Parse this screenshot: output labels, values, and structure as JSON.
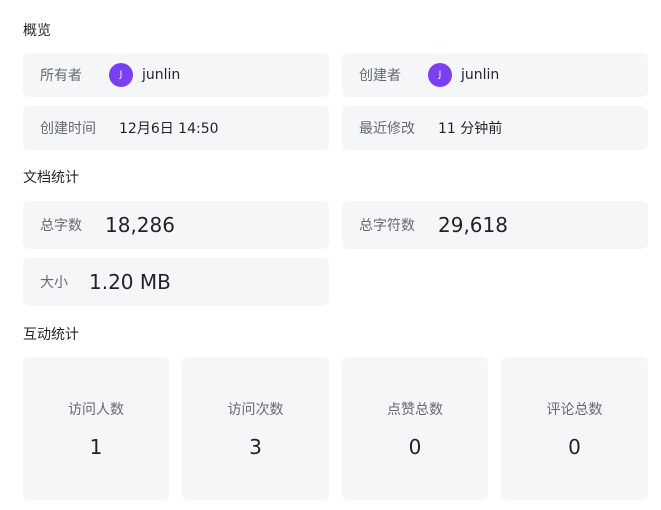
{
  "sections": {
    "overview": "概览",
    "doc_stats": "文档统计",
    "interaction_stats": "互动统计"
  },
  "overview": {
    "owner_label": "所有者",
    "owner_initial": "J",
    "owner_name": "junlin",
    "creator_label": "创建者",
    "creator_initial": "J",
    "creator_name": "junlin",
    "created_label": "创建时间",
    "created_value": "12月6日 14:50",
    "modified_label": "最近修改",
    "modified_value": "11 分钟前"
  },
  "doc_stats": {
    "total_chars_label": "总字数",
    "total_chars_value": "18,286",
    "total_symbols_label": "总字符数",
    "total_symbols_value": "29,618",
    "size_label": "大小",
    "size_value": "1.20 MB"
  },
  "interaction": {
    "visitors_label": "访问人数",
    "visitors_value": "1",
    "visits_label": "访问次数",
    "visits_value": "3",
    "likes_label": "点赞总数",
    "likes_value": "0",
    "comments_label": "评论总数",
    "comments_value": "0"
  },
  "colors": {
    "card_bg": "#f5f6f7",
    "avatar_bg": "#7b3ff2"
  }
}
